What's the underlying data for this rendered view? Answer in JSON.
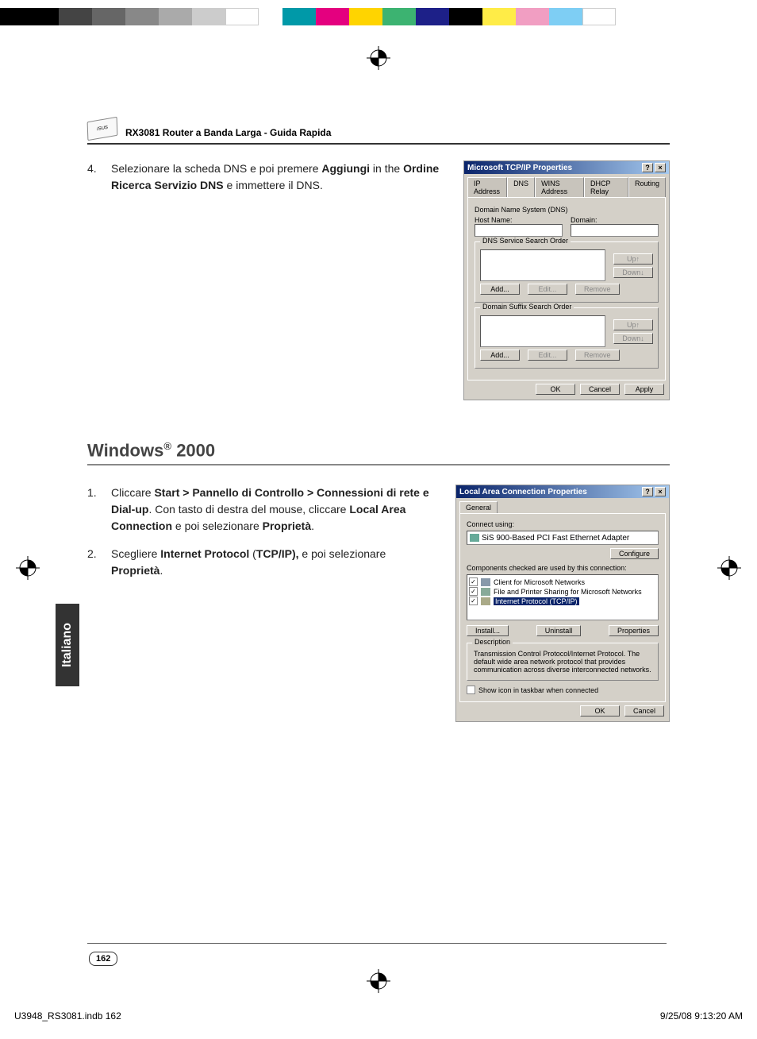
{
  "header_title": "RX3081 Router a Banda Larga - Guida Rapida",
  "step4": {
    "num": "4.",
    "pre": "Selezionare la scheda DNS e poi premere ",
    "b1": "Aggiungi",
    "mid1": " in the ",
    "b2": "Ordine Ricerca Servizio DNS",
    "post": " e immettere il DNS."
  },
  "dlg1": {
    "title": "Microsoft TCP/IP Properties",
    "tabs": [
      "IP Address",
      "DNS",
      "WINS Address",
      "DHCP Relay",
      "Routing"
    ],
    "group1": "Domain Name System (DNS)",
    "host_label": "Host Name:",
    "domain_label": "Domain:",
    "group2": "DNS Service Search Order",
    "group3": "Domain Suffix Search Order",
    "btns": {
      "up": "Up↑",
      "down": "Down↓",
      "add": "Add...",
      "edit": "Edit...",
      "remove": "Remove",
      "ok": "OK",
      "cancel": "Cancel",
      "apply": "Apply"
    }
  },
  "section2_title": "Windows",
  "section2_sup": "®",
  "section2_year": " 2000",
  "step1": {
    "num": "1.",
    "pre": "Cliccare ",
    "b1": "Start > Pannello di Controllo > Connessioni di rete e Dial-up",
    "mid1": ". Con tasto di destra del mouse, cliccare ",
    "b2": "Local Area Connection",
    "mid2": " e poi selezionare ",
    "b3": "Proprietà",
    "post": "."
  },
  "step2": {
    "num": "2.",
    "pre": "Scegliere ",
    "b1": "Internet Protocol ",
    "paren": "(",
    "b2": "TCP/IP),",
    "mid2": " e  poi selezionare ",
    "b3": "Proprietà",
    "post": "."
  },
  "dlg2": {
    "title": "Local Area Connection Properties",
    "tab": "General",
    "connect_using": "Connect using:",
    "adapter": "SiS 900-Based PCI Fast Ethernet Adapter",
    "configure": "Configure",
    "components_label": "Components checked are used by this connection:",
    "items": [
      "Client for Microsoft Networks",
      "File and Printer Sharing for Microsoft Networks",
      "Internet Protocol (TCP/IP)"
    ],
    "install": "Install...",
    "uninstall": "Uninstall",
    "properties": "Properties",
    "desc_label": "Description",
    "desc": "Transmission Control Protocol/Internet Protocol. The default wide area network protocol that provides communication across diverse interconnected networks.",
    "showicon": "Show icon in taskbar when connected",
    "ok": "OK",
    "cancel": "Cancel"
  },
  "lang_tab": "Italiano",
  "page_num": "162",
  "footer_left": "U3948_RS3081.indb   162",
  "footer_right": "9/25/08   9:13:20 AM",
  "colorbar": [
    "#000",
    "#444",
    "#666",
    "#888",
    "#aaa",
    "#ccc",
    "#fff",
    "#008080",
    "#e4007f",
    "#ffd400",
    "#009944",
    "#1d2088",
    "#000",
    "#ffec00",
    "#f19ec2",
    "#7ecef4",
    "#fff"
  ]
}
